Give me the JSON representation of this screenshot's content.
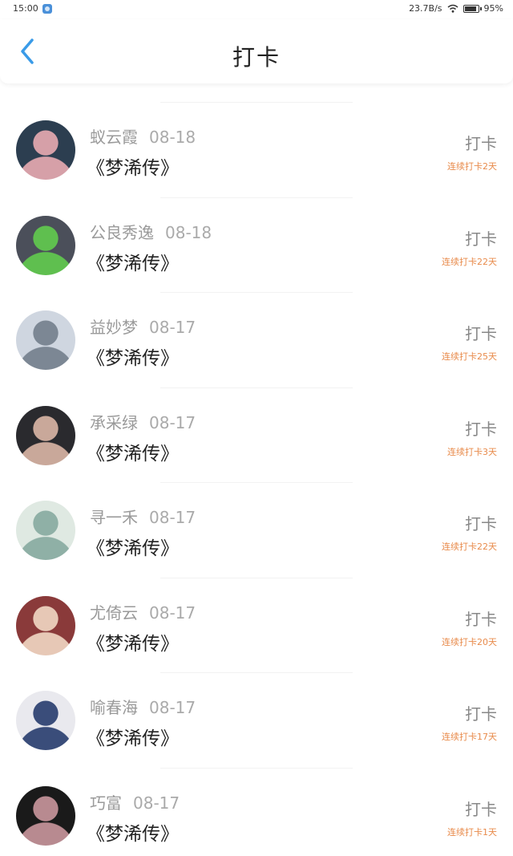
{
  "status_bar": {
    "time": "15:00",
    "net_speed": "23.7B/s",
    "battery": "95%"
  },
  "header": {
    "title": "打卡",
    "back_icon": "chevron-left-icon",
    "accent_color": "#3a9be8"
  },
  "checkins": [
    {
      "name": "蚁云霞",
      "date": "08-18",
      "book": "《梦浠传》",
      "action": "打卡",
      "streak": "连续打卡2天",
      "avatar_colors": [
        "#2c3e50",
        "#d6a0a8"
      ]
    },
    {
      "name": "公良秀逸",
      "date": "08-18",
      "book": "《梦浠传》",
      "action": "打卡",
      "streak": "连续打卡22天",
      "avatar_colors": [
        "#4b4f5a",
        "#5fbf4f"
      ]
    },
    {
      "name": "益妙梦",
      "date": "08-17",
      "book": "《梦浠传》",
      "action": "打卡",
      "streak": "连续打卡25天",
      "avatar_colors": [
        "#cfd6e0",
        "#7c8794"
      ]
    },
    {
      "name": "承采绿",
      "date": "08-17",
      "book": "《梦浠传》",
      "action": "打卡",
      "streak": "连续打卡3天",
      "avatar_colors": [
        "#2a2a2e",
        "#c9a89a"
      ]
    },
    {
      "name": "寻一禾",
      "date": "08-17",
      "book": "《梦浠传》",
      "action": "打卡",
      "streak": "连续打卡22天",
      "avatar_colors": [
        "#dfe9e2",
        "#8fb0a6"
      ]
    },
    {
      "name": "尤倚云",
      "date": "08-17",
      "book": "《梦浠传》",
      "action": "打卡",
      "streak": "连续打卡20天",
      "avatar_colors": [
        "#8a3a3a",
        "#e7c8b6"
      ]
    },
    {
      "name": "喻春海",
      "date": "08-17",
      "book": "《梦浠传》",
      "action": "打卡",
      "streak": "连续打卡17天",
      "avatar_colors": [
        "#e9e9ee",
        "#3a4d7a"
      ]
    },
    {
      "name": "巧富",
      "date": "08-17",
      "book": "《梦浠传》",
      "action": "打卡",
      "streak": "连续打卡1天",
      "avatar_colors": [
        "#1a1a1a",
        "#b88a90"
      ]
    }
  ]
}
